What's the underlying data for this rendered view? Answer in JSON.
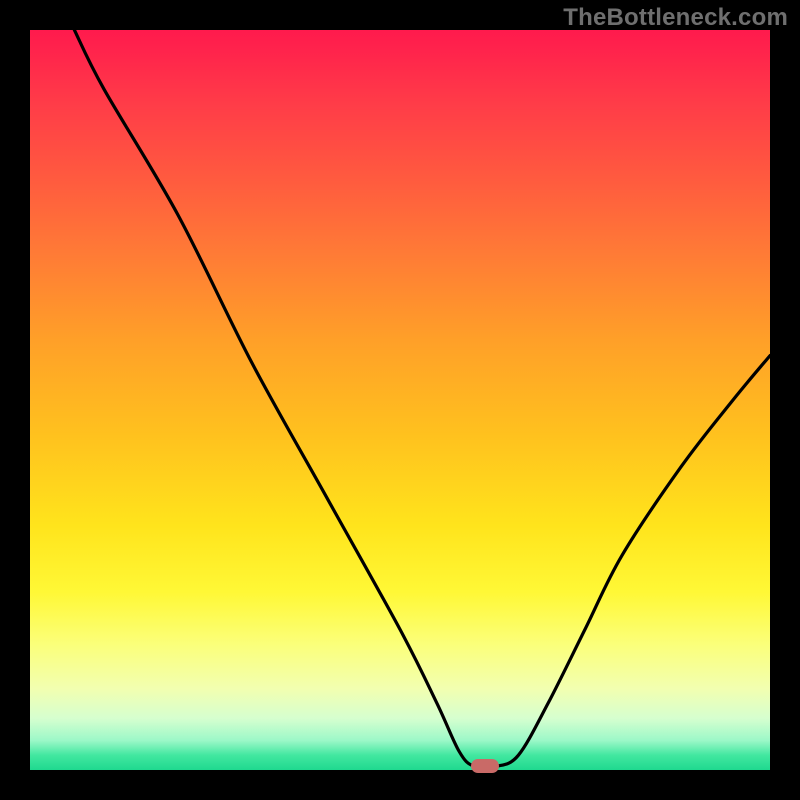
{
  "watermark": "TheBottleneck.com",
  "colors": {
    "page_bg": "#000000",
    "watermark_text": "#6f6f6f",
    "curve_stroke": "#000000",
    "marker_fill": "#c96a67"
  },
  "chart_data": {
    "type": "line",
    "title": "",
    "xlabel": "",
    "ylabel": "",
    "xlim": [
      0,
      100
    ],
    "ylim": [
      0,
      100
    ],
    "grid": false,
    "legend": false,
    "background_gradient_stops": [
      {
        "pos": 0.0,
        "color": "#ff1a4d"
      },
      {
        "pos": 0.1,
        "color": "#ff3c48"
      },
      {
        "pos": 0.2,
        "color": "#ff5a3f"
      },
      {
        "pos": 0.3,
        "color": "#ff7a36"
      },
      {
        "pos": 0.42,
        "color": "#ffa028"
      },
      {
        "pos": 0.55,
        "color": "#ffc21e"
      },
      {
        "pos": 0.67,
        "color": "#ffe41c"
      },
      {
        "pos": 0.76,
        "color": "#fff836"
      },
      {
        "pos": 0.83,
        "color": "#fbff7a"
      },
      {
        "pos": 0.89,
        "color": "#f2ffb0"
      },
      {
        "pos": 0.93,
        "color": "#d6ffcf"
      },
      {
        "pos": 0.96,
        "color": "#9cf8c8"
      },
      {
        "pos": 0.98,
        "color": "#42e7a0"
      },
      {
        "pos": 1.0,
        "color": "#1fd98f"
      }
    ],
    "series": [
      {
        "name": "bottleneck-curve",
        "x": [
          6.0,
          10.0,
          20.0,
          30.0,
          40.0,
          50.0,
          55.0,
          58.0,
          60.0,
          63.0,
          66.0,
          70.0,
          75.0,
          80.0,
          88.0,
          95.0,
          100.0
        ],
        "y": [
          100.0,
          92.0,
          75.0,
          55.0,
          37.0,
          19.0,
          9.0,
          2.5,
          0.5,
          0.5,
          2.0,
          9.0,
          19.0,
          29.0,
          41.0,
          50.0,
          56.0
        ]
      }
    ],
    "marker": {
      "x": 61.5,
      "y": 0.6
    }
  }
}
